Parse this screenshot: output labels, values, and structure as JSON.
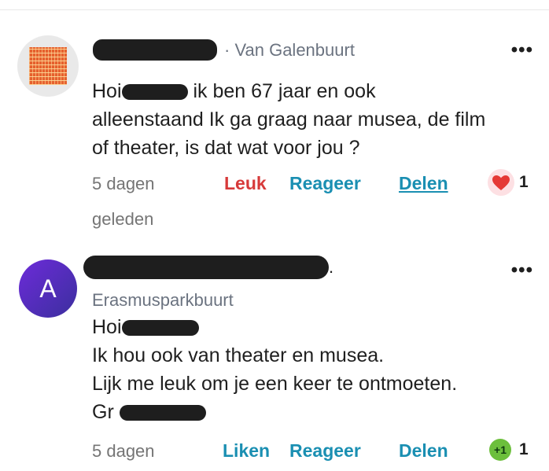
{
  "comment1": {
    "neighbourhood_prefix": "·",
    "neighbourhood": "Van Galenbuurt",
    "lines": {
      "l1_start": "Hoi",
      "l1_end": "ik ben 67 jaar en ook",
      "l2": "alleenstaand Ik ga graag naar musea, de film",
      "l3": "of theater, is dat wat voor jou ?"
    },
    "time_line1": "5 dagen",
    "time_line2": "geleden",
    "actions": {
      "like": "Leuk",
      "reply": "Reageer",
      "share": "Delen"
    },
    "reaction": {
      "icon": "heart",
      "count": "1"
    }
  },
  "comment2": {
    "avatar_letter": "A",
    "neighbourhood": "Erasmusparkbuurt",
    "lines": {
      "l1": "Hoi",
      "l2": "Ik hou ook van theater en musea.",
      "l3": "Lijk me leuk om je een keer te ontmoeten.",
      "l4": "Gr"
    },
    "time": "5 dagen",
    "actions": {
      "like": "Liken",
      "reply": "Reageer",
      "share": "Delen"
    },
    "reaction": {
      "icon": "+1",
      "count": "1"
    }
  },
  "more_menu": "•••",
  "colors": {
    "like_red": "#d73a3a",
    "link_teal": "#1a8fb2",
    "avatar_purple": "#5b2ccf",
    "plus_green": "#6cbf3c"
  }
}
